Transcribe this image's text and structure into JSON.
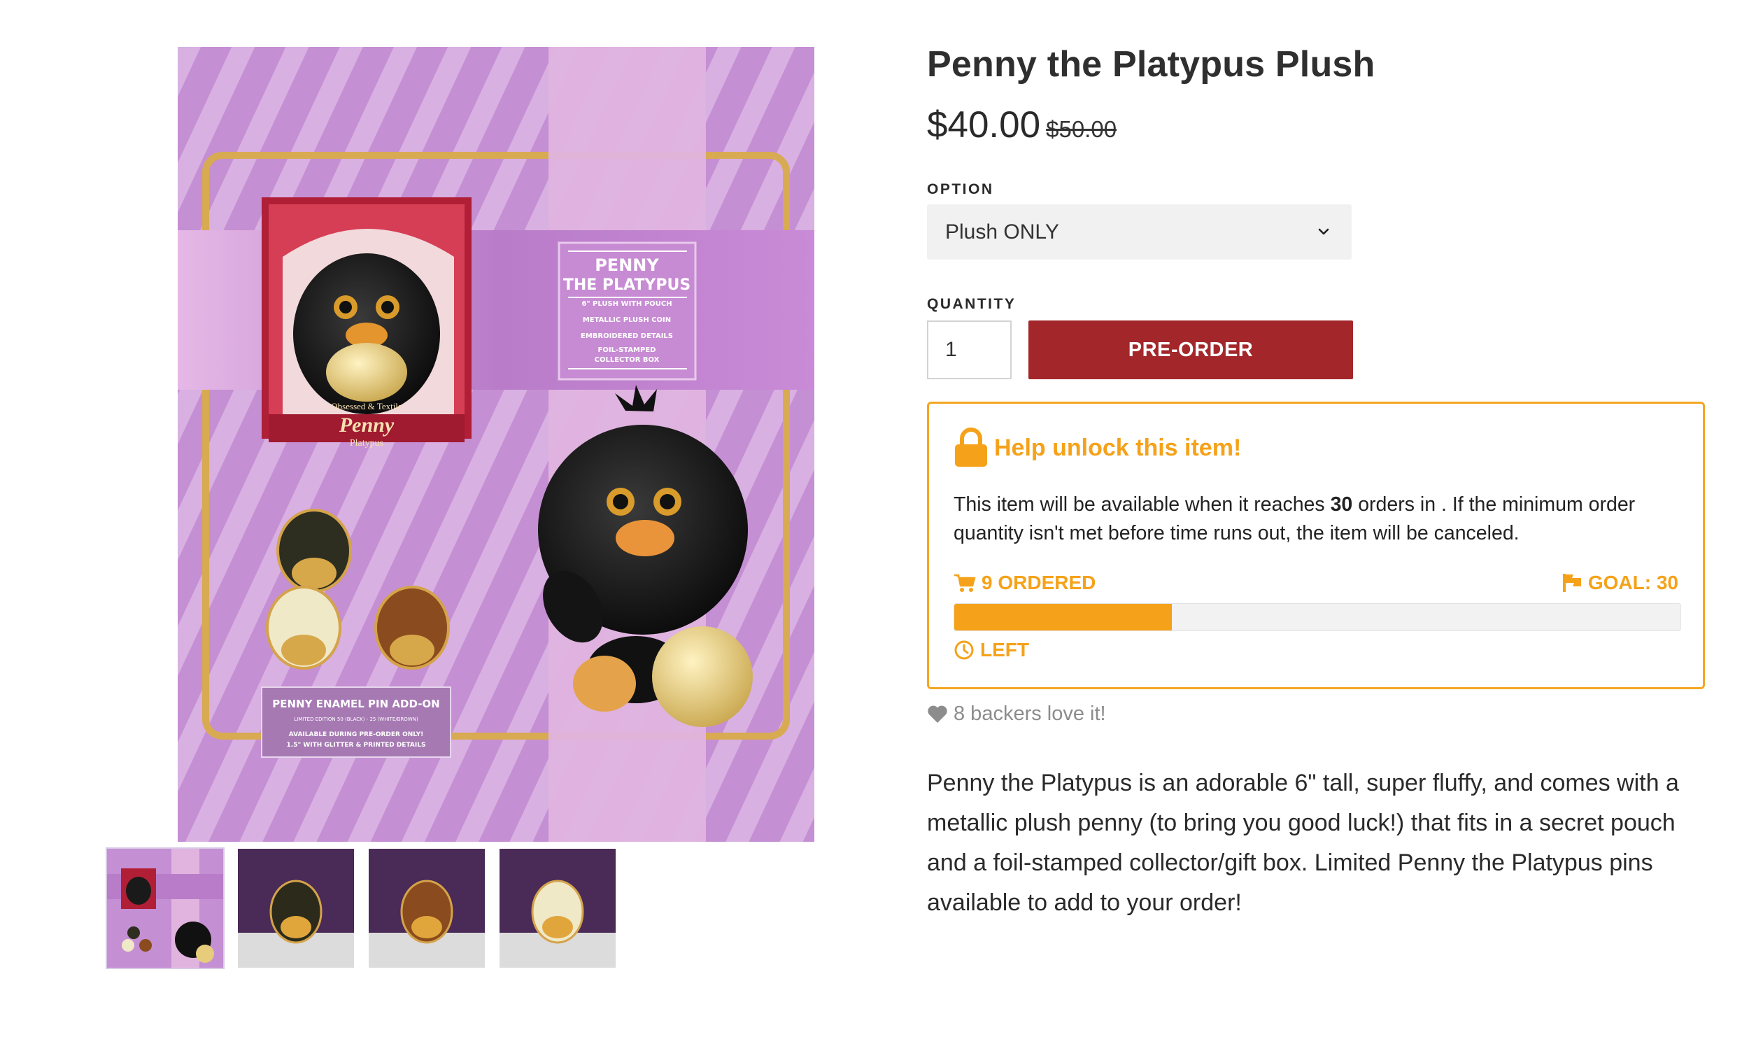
{
  "product": {
    "title": "Penny the Platypus Plush",
    "price": "$40.00",
    "compare_price": "$50.00"
  },
  "option": {
    "label": "OPTION",
    "selected": "Plush ONLY"
  },
  "quantity": {
    "label": "QUANTITY",
    "value": "1"
  },
  "buttons": {
    "preorder": "PRE-ORDER"
  },
  "gallery": {
    "box_title_line1": "PENNY",
    "box_title_line2": "THE PLATYPUS",
    "box_features": [
      "6\" PLUSH WITH POUCH",
      "METALLIC PLUSH COIN",
      "EMBROIDERED DETAILS",
      "FOIL-STAMPED",
      "COLLECTOR BOX"
    ],
    "pin_banner_title": "PENNY ENAMEL PIN ADD-ON",
    "pin_banner_sub": "LIMITED EDITION 50 (BLACK) - 25 (WHITE/BROWN)",
    "pin_banner_line3": "AVAILABLE DURING PRE-ORDER ONLY!",
    "pin_banner_line4": "1.5\" WITH GLITTER & PRINTED DETAILS",
    "box_brand": "Penny",
    "box_brand_sub": "Platypus",
    "box_brand_top": "Obsessed & Textile"
  },
  "unlock": {
    "title": "Help unlock this item!",
    "text_before": "This item will be available when it reaches ",
    "goal_number": "30",
    "text_after": " orders in . If the minimum order quantity isn't met before time runs out, the item will be canceled.",
    "ordered_label": "9 ORDERED",
    "goal_label": "GOAL: 30",
    "left_label": "LEFT",
    "progress_fraction": 0.3,
    "accent_color": "#f5a21a"
  },
  "backers": "8 backers love it!",
  "description": "Penny the Platypus is an adorable 6\" tall, super fluffy, and comes with a metallic plush penny (to bring you good luck!) that fits in a secret pouch and a foil-stamped collector/gift box. Limited Penny the Platypus pins available to add to your order!",
  "colors": {
    "button": "#a3272a",
    "accent": "#f5a21a",
    "background_purple": "#c79ad6"
  }
}
